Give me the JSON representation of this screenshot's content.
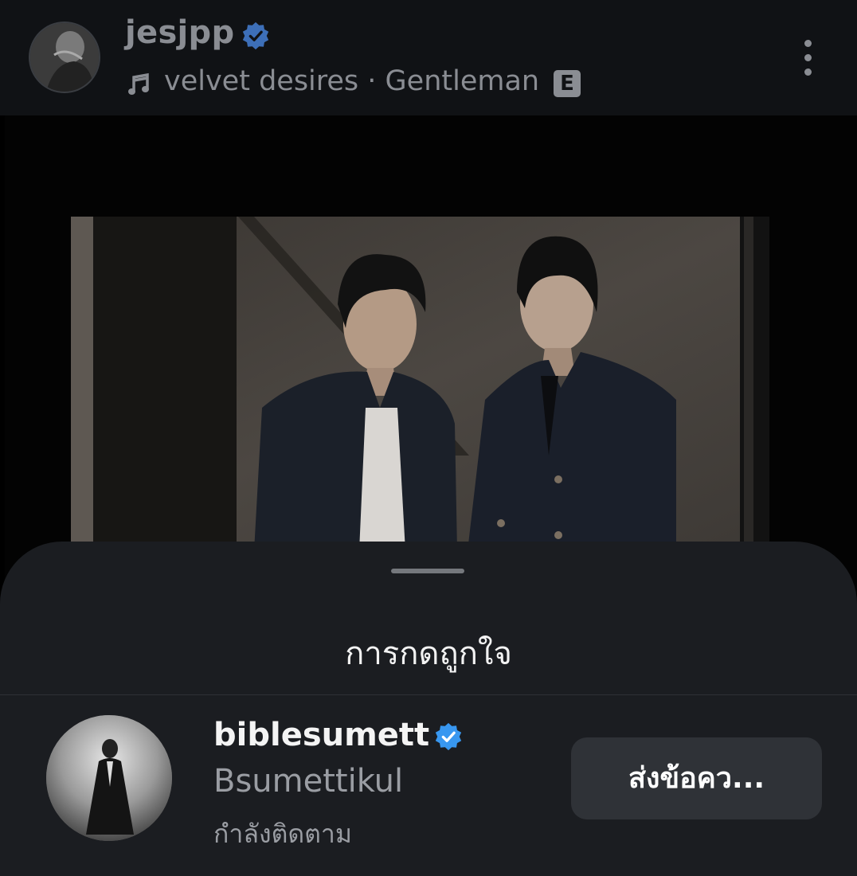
{
  "post": {
    "username": "jesjpp",
    "verified": true,
    "music": {
      "text": "velvet desires · Gentleman",
      "explicit_badge": "E",
      "icon": "music-note-icon"
    },
    "more_icon": "more-vertical-icon"
  },
  "likes_sheet": {
    "title": "การกดถูกใจ",
    "users": [
      {
        "handle": "biblesumett",
        "verified": true,
        "full_name": "Bsumettikul",
        "status": "กำลังติดตาม",
        "action_label": "ส่งข้อคว..."
      }
    ]
  },
  "colors": {
    "background": "#000000",
    "header_bg": "#101215",
    "sheet_bg": "#1b1d21",
    "verified_blue": "#3897f0",
    "button_bg": "#2f3237"
  }
}
